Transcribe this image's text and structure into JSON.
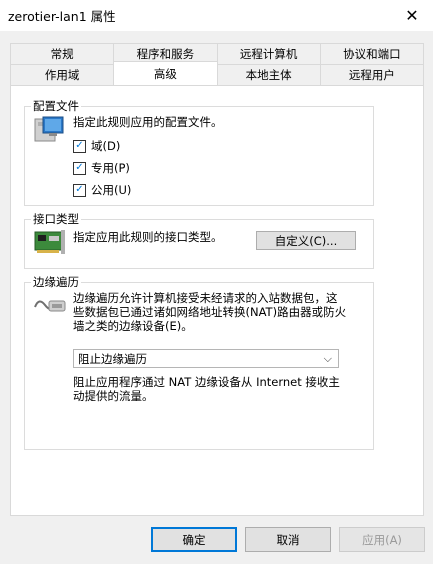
{
  "window": {
    "title": "zerotier-lan1 属性",
    "close_glyph": "✕"
  },
  "tabs_row1": [
    "常规",
    "程序和服务",
    "远程计算机",
    "协议和端口"
  ],
  "tabs_row2": [
    "作用域",
    "高级",
    "本地主体",
    "远程用户"
  ],
  "active_tab": "高级",
  "profiles": {
    "title": "配置文件",
    "description": "指定此规则应用的配置文件。",
    "options": [
      {
        "label": "域(D)",
        "checked": true
      },
      {
        "label": "专用(P)",
        "checked": true
      },
      {
        "label": "公用(U)",
        "checked": true
      }
    ]
  },
  "interface": {
    "title": "接口类型",
    "description": "指定应用此规则的接口类型。",
    "button": "自定义(C)..."
  },
  "edge": {
    "title": "边缘遍历",
    "description_1": "边缘遍历允许计算机接受未经请求的入站数据包，这",
    "description_2": "些数据包已通过诸如网络地址转换(NAT)路由器或防火",
    "description_3": "墙之类的边缘设备(E)。",
    "selected": "阻止边缘遍历",
    "hint_1": "阻止应用程序通过 NAT 边缘设备从 Internet 接收主",
    "hint_2": "动提供的流量。"
  },
  "footer": {
    "ok": "确定",
    "cancel": "取消",
    "apply": "应用(A)"
  },
  "icons": {
    "profiles": "computer-icon",
    "interface": "network-card-icon",
    "edge": "edge-device-icon"
  },
  "colors": {
    "accent": "#0078d7",
    "check": "#0078d7"
  }
}
